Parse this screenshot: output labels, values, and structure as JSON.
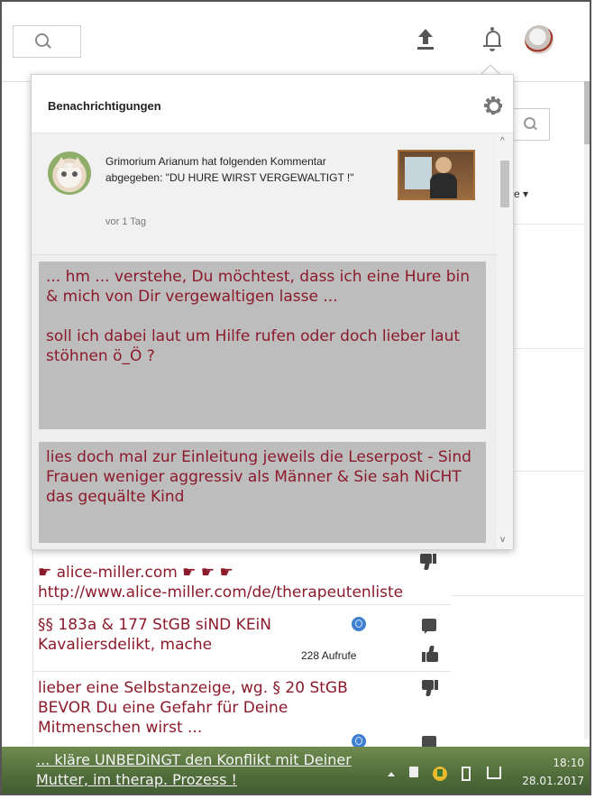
{
  "header": {
    "search_icon": "search-icon",
    "upload_icon": "upload-icon",
    "notifications_icon": "bell-icon",
    "avatar": "avatar"
  },
  "background": {
    "right_dropdown_text": "e ▾",
    "comments": [
      {
        "lines": [
          "☛ alice-miller.com ☛ ☛ ☛",
          "http://www.alice-miller.com/de/therapeutenliste"
        ]
      },
      {
        "lines": [
          "§§ 183a & 177 StGB siND KEiN",
          "Kavaliersdelikt, mache"
        ],
        "views": "228 Aufrufe"
      },
      {
        "lines": [
          "lieber eine Selbstanzeige, wg. § 20 StGB",
          "BEVOR Du eine Gefahr für Deine",
          "Mitmenschen wirst ..."
        ]
      }
    ]
  },
  "notifications": {
    "title": "Benachrichtigungen",
    "items": [
      {
        "text": "Grimorium Arianum hat folgenden Kommentar abgegeben: \"DU HURE WIRST VERGEWALTIGT !\"",
        "time": "vor 1 Tag"
      }
    ],
    "overlay_texts": [
      "... hm ... verstehe, Du möchtest, dass ich eine Hure bin & mich von Dir vergewaltigen lasse ...\n\nsoll ich dabei laut um Hilfe rufen oder doch lieber laut stöhnen ö_Ö ?",
      "lies doch mal zur Einleitung jeweils die Leserpost - Sind Frauen weniger aggressiv als Männer & Sie sah NiCHT das gequälte Kind"
    ]
  },
  "taskbar": {
    "message": "... kläre UNBEDiNGT den Konflikt mit Deiner Mutter, im therap. Prozess !",
    "time": "18:10",
    "date": "28.01.2017"
  },
  "colors": {
    "comment_text": "#8b1a2b",
    "overlay_bg": "#bdbdbd",
    "taskbar_bg": "#4f6b3a"
  }
}
